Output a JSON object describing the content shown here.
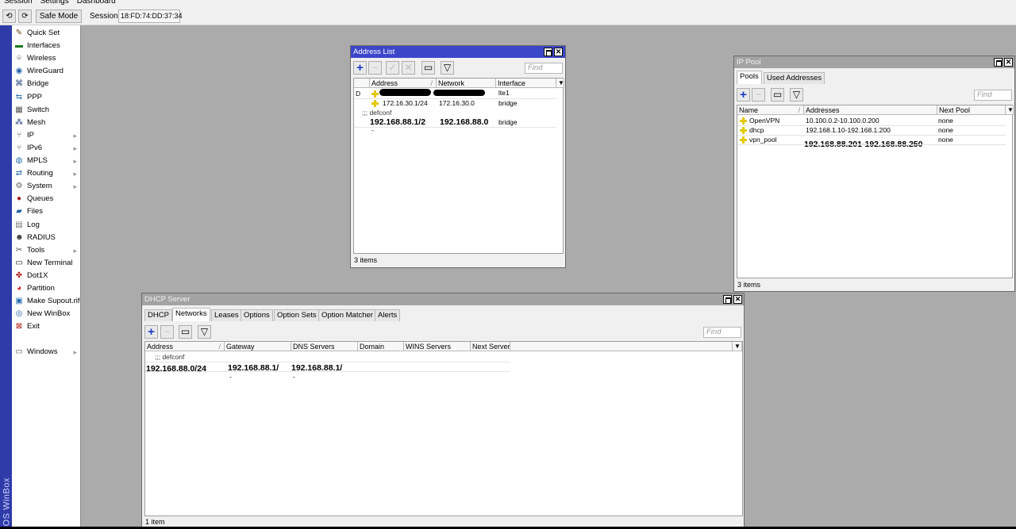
{
  "menubar": [
    "Session",
    "Settings",
    "Dashboard"
  ],
  "toolbar": {
    "undo": "⟲",
    "redo": "⟳",
    "safe_mode": "Safe Mode",
    "session_label": "Session:",
    "session_value": "18:FD:74:DD:37:34"
  },
  "brand": "RouterOS WinBox",
  "sidebar": [
    {
      "label": "Quick Set",
      "icon": "quick-set-icon",
      "glyph": "✎",
      "color": "#6b4b1e",
      "arrow": ""
    },
    {
      "label": "Interfaces",
      "icon": "interfaces-icon",
      "glyph": "▬",
      "color": "#1f7a1f",
      "arrow": ""
    },
    {
      "label": "Wireless",
      "icon": "wireless-icon",
      "glyph": "⌾",
      "color": "#555",
      "arrow": ""
    },
    {
      "label": "WireGuard",
      "icon": "wireguard-icon",
      "glyph": "◉",
      "color": "#1f5fa8",
      "arrow": ""
    },
    {
      "label": "Bridge",
      "icon": "bridge-icon",
      "glyph": "⌘",
      "color": "#1f3e7a",
      "arrow": ""
    },
    {
      "label": "PPP",
      "icon": "ppp-icon",
      "glyph": "⇆",
      "color": "#2a6db0",
      "arrow": ""
    },
    {
      "label": "Switch",
      "icon": "switch-icon",
      "glyph": "▦",
      "color": "#555",
      "arrow": ""
    },
    {
      "label": "Mesh",
      "icon": "mesh-icon",
      "glyph": "⁂",
      "color": "#1f3e7a",
      "arrow": ""
    },
    {
      "label": "IP",
      "icon": "ip-icon",
      "glyph": "⑂",
      "color": "#555",
      "arrow": "▸"
    },
    {
      "label": "IPv6",
      "icon": "ipv6-icon",
      "glyph": "⑂",
      "color": "#555",
      "arrow": "▸"
    },
    {
      "label": "MPLS",
      "icon": "mpls-icon",
      "glyph": "◍",
      "color": "#2a6db0",
      "arrow": "▸"
    },
    {
      "label": "Routing",
      "icon": "routing-icon",
      "glyph": "⇄",
      "color": "#2a6db0",
      "arrow": "▸"
    },
    {
      "label": "System",
      "icon": "system-icon",
      "glyph": "⚙",
      "color": "#666",
      "arrow": "▸"
    },
    {
      "label": "Queues",
      "icon": "queues-icon",
      "glyph": "●",
      "color": "#a01818",
      "arrow": ""
    },
    {
      "label": "Files",
      "icon": "files-icon",
      "glyph": "▰",
      "color": "#1f5fa8",
      "arrow": ""
    },
    {
      "label": "Log",
      "icon": "log-icon",
      "glyph": "▤",
      "color": "#777",
      "arrow": ""
    },
    {
      "label": "RADIUS",
      "icon": "radius-icon",
      "glyph": "☻",
      "color": "#333",
      "arrow": ""
    },
    {
      "label": "Tools",
      "icon": "tools-icon",
      "glyph": "✂",
      "color": "#555",
      "arrow": "▸"
    },
    {
      "label": "New Terminal",
      "icon": "terminal-icon",
      "glyph": "▭",
      "color": "#111",
      "arrow": ""
    },
    {
      "label": "Dot1X",
      "icon": "dot1x-icon",
      "glyph": "✤",
      "color": "#b01c1c",
      "arrow": ""
    },
    {
      "label": "Partition",
      "icon": "partition-icon",
      "glyph": "◕",
      "color": "#c22",
      "arrow": ""
    },
    {
      "label": "Make Supout.rif",
      "icon": "supout-icon",
      "glyph": "▣",
      "color": "#2a6db0",
      "arrow": ""
    },
    {
      "label": "New WinBox",
      "icon": "winbox-icon",
      "glyph": "◎",
      "color": "#1f5fa8",
      "arrow": ""
    },
    {
      "label": "Exit",
      "icon": "exit-icon",
      "glyph": "⊠",
      "color": "#b01c1c",
      "arrow": ""
    },
    {
      "label": "Windows",
      "icon": "windows-icon",
      "glyph": "▭",
      "color": "#555",
      "arrow": "▸"
    }
  ],
  "address_list": {
    "title": "Address List",
    "find_placeholder": "Find",
    "columns": [
      "Address",
      "Network",
      "Interface"
    ],
    "sort_marker": "/",
    "rows": [
      {
        "flag": "D",
        "address": "",
        "network": "",
        "interface": "lte1"
      },
      {
        "flag": "",
        "address": "172.16.30.1/24",
        "network": "172.16.30.0",
        "interface": "bridge"
      },
      {
        "comment": ";;; defconf"
      },
      {
        "flag": "",
        "address": "192.168.88.1/2",
        "network": "192.168.88.0",
        "interface": "bridge",
        "wrap": "-"
      }
    ],
    "status": "3 items"
  },
  "ip_pool": {
    "title": "IP Pool",
    "tabs": [
      "Pools",
      "Used Addresses"
    ],
    "find_placeholder": "Find",
    "columns": [
      "Name",
      "Addresses",
      "Next Pool"
    ],
    "sort_marker": "/",
    "rows": [
      {
        "name": "OpenVPN",
        "addresses": "10.100.0.2-10.100.0.200",
        "next_pool": "none"
      },
      {
        "name": "dhcp",
        "addresses": "192.168.1.10-192.168.1.200",
        "next_pool": "none"
      },
      {
        "name": "vpn_pool",
        "addresses": "192.168.88.201-192.168.88.250",
        "next_pool": "none"
      }
    ],
    "status": "3 items"
  },
  "dhcp_server": {
    "title": "DHCP Server",
    "tabs": [
      "DHCP",
      "Networks",
      "Leases",
      "Options",
      "Option Sets",
      "Option Matcher",
      "Alerts"
    ],
    "selected_tab": "Networks",
    "find_placeholder": "Find",
    "columns": [
      "Address",
      "Gateway",
      "DNS Servers",
      "Domain",
      "WINS Servers",
      "Next Server"
    ],
    "sort_marker": "/",
    "comment": ";;; defconf",
    "row": {
      "address": "192.168.88.0/24",
      "gateway": "192.168.88.1/",
      "dns": "192.168.88.1/",
      "wrap": "-"
    },
    "status": "1 item"
  },
  "colors": {
    "title_active": "#3c46c8",
    "sidebar_strip": "#2f3ba8",
    "desktop": "#ababab"
  }
}
